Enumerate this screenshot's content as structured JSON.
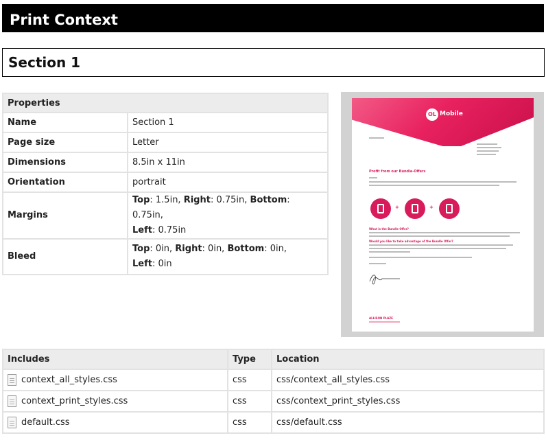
{
  "header": {
    "title": "Print Context"
  },
  "section": {
    "title": "Section 1"
  },
  "properties": {
    "heading": "Properties",
    "rows": [
      {
        "key": "Name",
        "value": "Section 1"
      },
      {
        "key": "Page size",
        "value": "Letter"
      },
      {
        "key": "Dimensions",
        "value": "8.5in x 11in"
      },
      {
        "key": "Orientation",
        "value": "portrait"
      }
    ],
    "margins": {
      "key": "Margins",
      "top_label": "Top",
      "top": ": 1.5in, ",
      "right_label": "Right",
      "right": ": 0.75in, ",
      "bottom_label": "Bottom",
      "bottom": ": 0.75in,",
      "left_label": "Left",
      "left": ": 0.75in"
    },
    "bleed": {
      "key": "Bleed",
      "top_label": "Top",
      "top": ": 0in, ",
      "right_label": "Right",
      "right": ": 0in, ",
      "bottom_label": "Bottom",
      "bottom": ": 0in,",
      "left_label": "Left",
      "left": ": 0in"
    }
  },
  "preview": {
    "logo_badge": "OL",
    "logo_text": "Mobile",
    "doc_heading": "Profit from our Bundle-Offers",
    "sub1": "What is the Bundle Offer?",
    "sub2": "Would you like to take advantage of the Bundle Offer?",
    "footer_name": "ALLISON PLAZE",
    "brand_color": "#e8215f"
  },
  "includes": {
    "headers": {
      "name": "Includes",
      "type": "Type",
      "location": "Location"
    },
    "files": [
      {
        "name": "context_all_styles.css",
        "type": "css",
        "location": "css/context_all_styles.css"
      },
      {
        "name": "context_print_styles.css",
        "type": "css",
        "location": "css/context_print_styles.css"
      },
      {
        "name": "default.css",
        "type": "css",
        "location": "css/default.css"
      }
    ]
  }
}
